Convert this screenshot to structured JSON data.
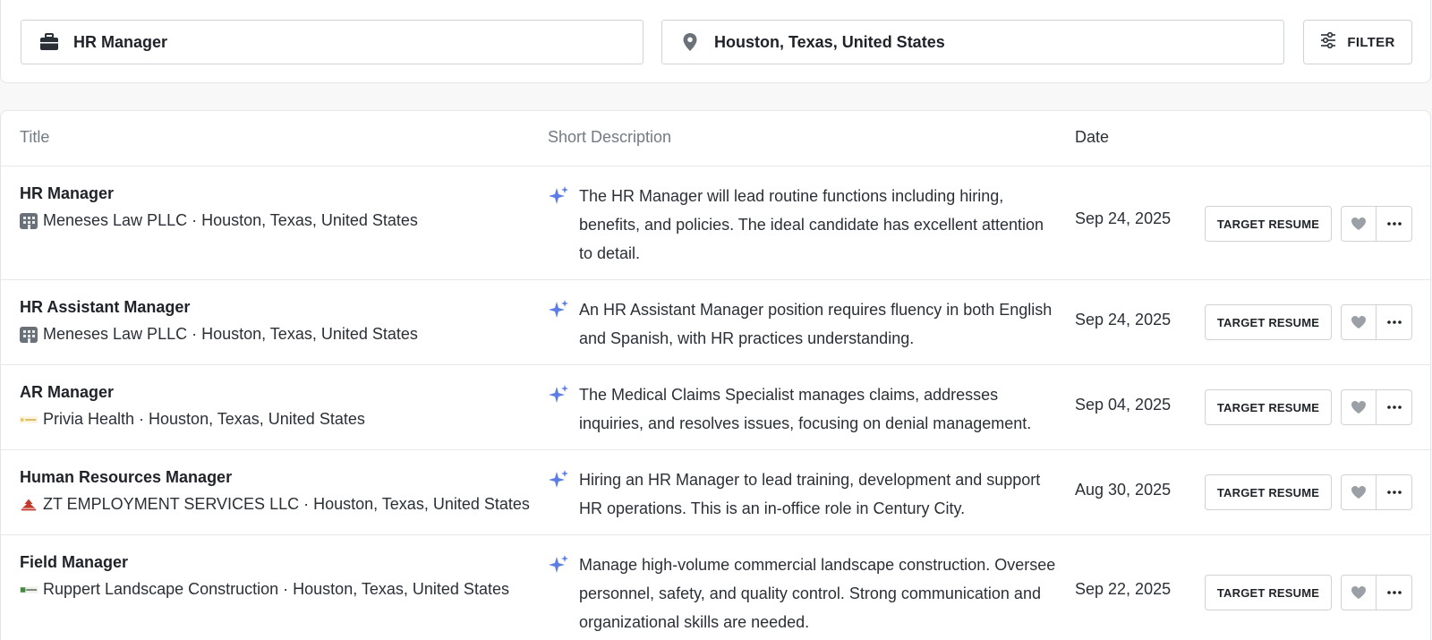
{
  "search": {
    "job_query": "HR Manager",
    "job_icon": "briefcase-icon",
    "location_query": "Houston, Texas, United States",
    "location_icon": "map-pin-icon",
    "filter_label": "FILTER",
    "filter_icon": "sliders-icon"
  },
  "table": {
    "columns": {
      "title": "Title",
      "description": "Short Description",
      "date": "Date"
    },
    "action_label": "TARGET RESUME",
    "rows": [
      {
        "title": "HR Manager",
        "company_line": "Meneses Law PLLC · Houston, Texas, United States",
        "logo": "building-icon",
        "description": "The HR Manager will lead routine functions including hiring, benefits, and policies. The ideal candidate has excellent attention to detail.",
        "date": "Sep 24, 2025"
      },
      {
        "title": "HR Assistant Manager",
        "company_line": "Meneses Law PLLC · Houston, Texas, United States",
        "logo": "building-icon",
        "description": "An HR Assistant Manager position requires fluency in both English and Spanish, with HR practices understanding.",
        "date": "Sep 24, 2025"
      },
      {
        "title": "AR Manager",
        "company_line": "Privia Health · Houston, Texas, United States",
        "logo": "privia-logo",
        "description": "The Medical Claims Specialist manages claims, addresses inquiries, and resolves issues, focusing on denial management.",
        "date": "Sep 04, 2025"
      },
      {
        "title": "Human Resources Manager",
        "company_line": "ZT EMPLOYMENT SERVICES LLC · Houston, Texas, United States",
        "logo": "zt-logo",
        "description": "Hiring an HR Manager to lead training, development and support HR operations. This is an in-office role in Century City.",
        "date": "Aug 30, 2025"
      },
      {
        "title": "Field Manager",
        "company_line": "Ruppert Landscape Construction · Houston, Texas, United States",
        "logo": "ruppert-logo",
        "description": "Manage high-volume commercial landscape construction. Oversee personnel, safety, and quality control. Strong communication and organizational skills are needed.",
        "date": "Sep 22, 2025"
      }
    ]
  },
  "colors": {
    "sparkle": "#5b7ee5",
    "heart": "#9aa0a6",
    "border": "#cfd3d8"
  }
}
